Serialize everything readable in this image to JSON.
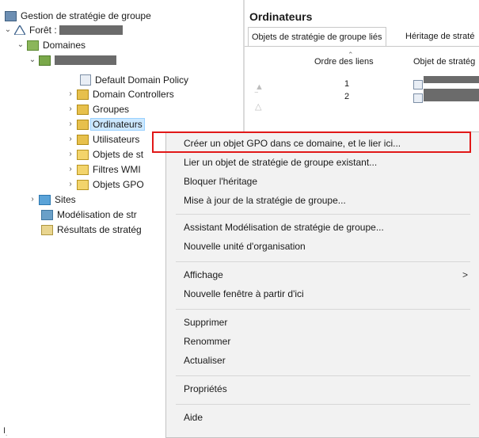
{
  "tree": {
    "root": "Gestion de stratégie de groupe",
    "forest": "Forêt :",
    "domains": "Domaines",
    "default_policy": "Default Domain Policy",
    "domain_controllers": "Domain Controllers",
    "groupes": "Groupes",
    "ordinateurs": "Ordinateurs",
    "utilisateurs": "Utilisateurs",
    "objets_strat": "Objets de st",
    "filtres_wmi": "Filtres WMI",
    "objets_gpo": "Objets GPO",
    "sites": "Sites",
    "modelisation": "Modélisation de str",
    "resultats": "Résultats de stratég"
  },
  "right": {
    "title": "Ordinateurs",
    "tab_active": "Objets de stratégie de groupe liés",
    "tab_other": "Héritage de straté",
    "col_order": "Ordre des liens",
    "col_object": "Objet de stratég",
    "rows": [
      "1",
      "2"
    ]
  },
  "menu": {
    "items": [
      "Créer un objet GPO dans ce domaine, et le lier ici...",
      "Lier un objet de stratégie de groupe existant...",
      "Bloquer l'héritage",
      "Mise à jour de la stratégie de groupe...",
      "Assistant Modélisation de stratégie de groupe...",
      "Nouvelle unité d'organisation",
      "Affichage",
      "Nouvelle fenêtre à partir d'ici",
      "Supprimer",
      "Renommer",
      "Actualiser",
      "Propriétés",
      "Aide"
    ],
    "submenu_arrow": ">"
  },
  "colors": {
    "highlight": "#e11818",
    "selection": "#cce8ff"
  }
}
